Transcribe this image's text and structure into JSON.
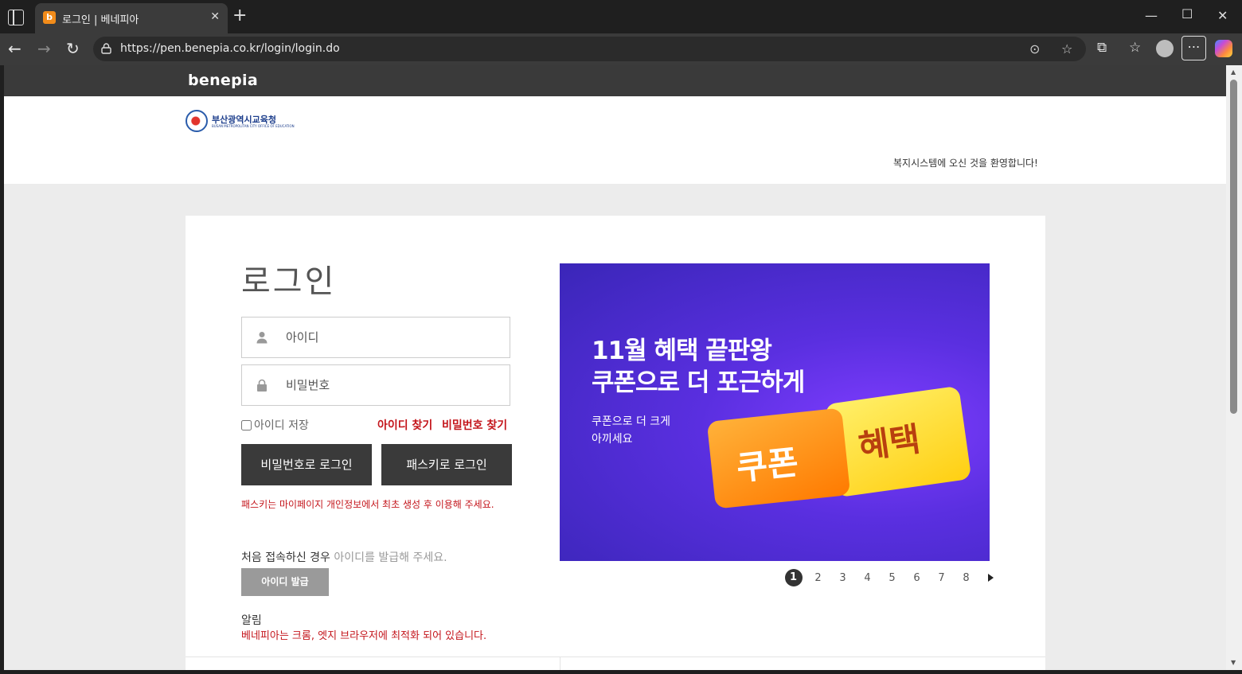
{
  "browser": {
    "tab_title": "로그인 | 베네피아",
    "tab_favicon": "b",
    "url": "https://pen.benepia.co.kr/login/login.do"
  },
  "site": {
    "brand": "benepia",
    "org_logo_text": "부산광역시교육청",
    "org_logo_sub": "BUSAN METROPOLITAN CITY OFFICE OF EDUCATION",
    "welcome": "복지시스템에 오신 것을 환영합니다!"
  },
  "login": {
    "title": "로그인",
    "id_placeholder": "아이디",
    "pw_placeholder": "비밀번호",
    "remember_label": "아이디 저장",
    "find_id": "아이디 찾기",
    "find_pw": "비밀번호 찾기",
    "pw_login_btn": "비밀번호로 로그인",
    "passkey_login_btn": "패스키로 로그인",
    "passkey_note": "패스키는 마이페이지 개인정보에서 최초 생성 후 이용해 주세요.",
    "first_visit": "처음 접속하신 경우",
    "first_visit_hint": "아이디를 발급해 주세요.",
    "issue_btn": "아이디 발급",
    "notice_title": "알림",
    "notice_text": "베네피아는 크롬, 엣지 브라우저에 최적화 되어 있습니다."
  },
  "banner": {
    "headline_1": "11월 혜택 끝판왕",
    "headline_2": "쿠폰으로 더 포근하게",
    "sub_1": "쿠폰으로 더 크게",
    "sub_2": "아끼세요",
    "ticket_left": "쿠폰",
    "ticket_right": "혜택",
    "pages": [
      "1",
      "2",
      "3",
      "4",
      "5",
      "6",
      "7",
      "8"
    ],
    "active_page": "1"
  }
}
